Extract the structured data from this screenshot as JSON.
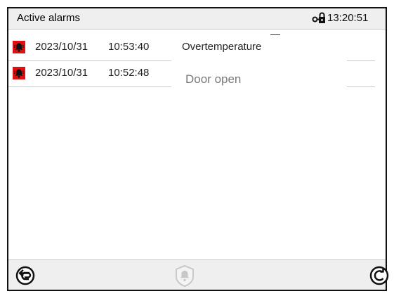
{
  "header": {
    "title": "Active alarms",
    "clock": "13:20:51",
    "lock_icon": "lock-key-icon"
  },
  "alarms": [
    {
      "date": "2023/10/31",
      "time": "10:53:40",
      "message": "Overtemperature",
      "icon": "alarm-bell-icon"
    },
    {
      "date": "2023/10/31",
      "time": "10:52:48",
      "message": "Door open",
      "icon": "alarm-bell-icon"
    }
  ],
  "footer": {
    "back_icon": "back-arrow-icon",
    "acknowledge_icon": "alarm-acknowledge-icon",
    "refresh_icon": "refresh-icon"
  },
  "colors": {
    "alarm_red": "#e01010",
    "header_bg": "#efefef"
  }
}
